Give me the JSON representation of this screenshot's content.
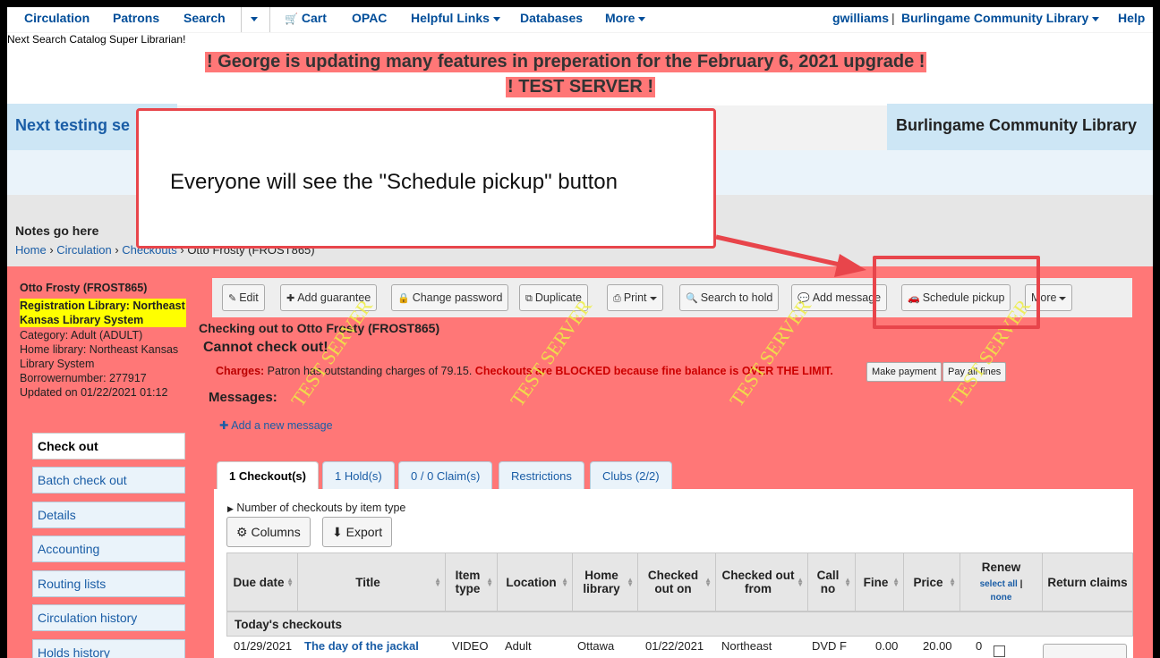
{
  "topnav": {
    "circulation": "Circulation",
    "patrons": "Patrons",
    "search": "Search",
    "cart": "Cart",
    "opac": "OPAC",
    "helpful_links": "Helpful Links",
    "databases": "Databases",
    "more": "More",
    "user": "gwilliams",
    "separator": "|",
    "library": "Burlingame Community Library",
    "help": "Help"
  },
  "catalog_line": "Next Search Catalog Super Librarian!",
  "banners": {
    "line1": "! George is updating many features in preperation for the February 6, 2021 upgrade !",
    "line2": "! TEST SERVER !"
  },
  "blue_left": "Next testing se",
  "blue_right": "Burlingame Community Library",
  "notes": "Notes go here",
  "breadcrumb": {
    "home": "Home",
    "circulation": "Circulation",
    "checkouts": "Checkouts",
    "current": "Otto Frosty (FROST865)",
    "sep": "›"
  },
  "patron": {
    "name": "Otto Frosty (FROST865)",
    "registration_library": "Registration Library: Northeast Kansas Library System",
    "category": "Category: Adult (ADULT)",
    "home_library": "Home library: Northeast Kansas Library System",
    "borrowernumber": "Borrowernumber: 277917",
    "updated": "Updated on 01/22/2021 01:12"
  },
  "left_menu": [
    "Check out",
    "Batch check out",
    "Details",
    "Accounting",
    "Routing lists",
    "Circulation history",
    "Holds history"
  ],
  "toolbar": {
    "edit": "Edit",
    "add_guarantee": "Add guarantee",
    "change_password": "Change password",
    "duplicate": "Duplicate",
    "print": "Print",
    "search_to_hold": "Search to hold",
    "add_message": "Add message",
    "schedule_pickup": "Schedule pickup",
    "more": "More"
  },
  "checkout": {
    "checking_out_to": "Checking out to Otto Frosty (FROST865)",
    "cannot": "Cannot check out!",
    "charges_label": "Charges:",
    "charges_text": "Patron has outstanding charges of 79.15.",
    "blocked": "Checkouts are BLOCKED because fine balance is OVER THE LIMIT.",
    "make_payment": "Make payment",
    "pay_all": "Pay all fines",
    "messages": "Messages:",
    "add_message": "Add a new message"
  },
  "tabs": [
    "1 Checkout(s)",
    "1 Hold(s)",
    "0 / 0 Claim(s)",
    "Restrictions",
    "Clubs (2/2)"
  ],
  "panel": {
    "num_checkouts": "Number of checkouts by item type",
    "columns": "Columns",
    "export": "Export"
  },
  "table": {
    "headers": [
      "Due date",
      "Title",
      "Item type",
      "Location",
      "Home library",
      "Checked out on",
      "Checked out from",
      "Call no",
      "Fine",
      "Price",
      "Renew",
      "Return claims"
    ],
    "renew_select": "select all",
    "renew_none": "none",
    "renew_sep": "|",
    "todays": "Today's checkouts",
    "row": [
      "01/29/2021",
      "The day of the jackal",
      "VIDEO",
      "Adult",
      "Ottawa",
      "01/22/2021",
      "Northeast",
      "DVD F",
      "0.00",
      "20.00",
      "0"
    ]
  },
  "watermark": "TEST SERVER",
  "callout": "Everyone will see the \"Schedule pickup\" button",
  "colors": {
    "page_pink": "#ff7777",
    "callout_red": "#e8454b",
    "link_blue": "#1a5da6"
  }
}
